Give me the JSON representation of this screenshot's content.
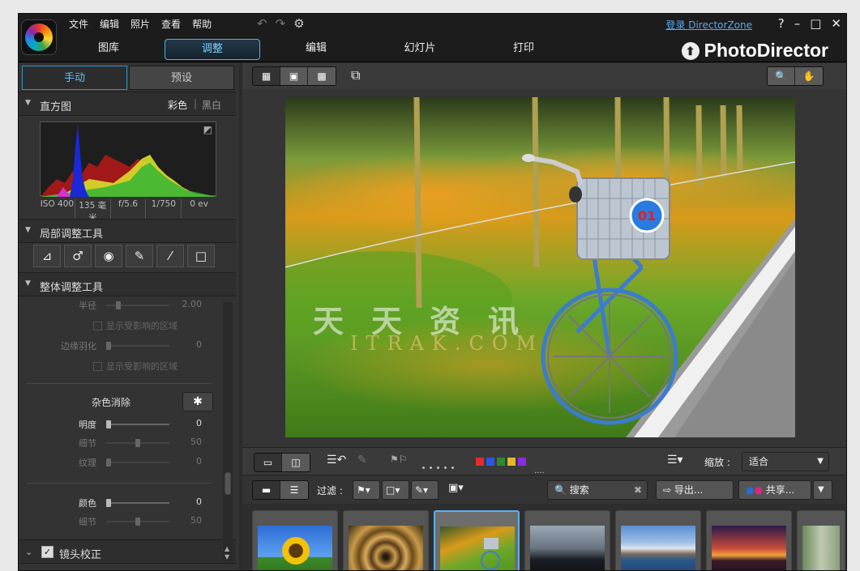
{
  "menu": [
    "文件",
    "编辑",
    "照片",
    "查看",
    "帮助"
  ],
  "toolbar_icons": [
    "undo-icon",
    "redo-icon",
    "settings-icon"
  ],
  "login_link": "登录 DirectorZone",
  "window_controls": {
    "help": "?",
    "minimize": "–",
    "maximize": "□",
    "close": "✕"
  },
  "main_tabs": [
    {
      "label": "图库",
      "active": false
    },
    {
      "label": "调整",
      "active": true
    },
    {
      "label": "编辑",
      "active": false
    },
    {
      "label": "幻灯片",
      "active": false
    },
    {
      "label": "打印",
      "active": false
    }
  ],
  "brand": "PhotoDirector",
  "left": {
    "subtabs": [
      "手动",
      "预设"
    ],
    "histogram": {
      "title": "直方图",
      "mode_color": "彩色",
      "mode_bw": "黑白",
      "exif": [
        "ISO 400",
        "135 毫米",
        "f/5.6",
        "1/750",
        "0 ev"
      ]
    },
    "local_tools": {
      "title": "局部调整工具",
      "icons": [
        "crop-icon",
        "spot-removal-icon",
        "red-eye-icon",
        "brush-icon",
        "gradient-icon",
        "radial-icon"
      ]
    },
    "global_tools": {
      "title": "整体调整工具"
    },
    "sliders1": [
      {
        "label": "半径",
        "value": "2.00",
        "pos": 0.15
      },
      {
        "label": "边缘羽化",
        "value": "0",
        "pos": 0.0
      }
    ],
    "show_affected": "显示受影响的区域",
    "noise": {
      "title": "杂色消除",
      "icon": "magic-wand-icon"
    },
    "sliders2": [
      {
        "label": "明度",
        "value": "0",
        "pos": 0.0,
        "dim": false
      },
      {
        "label": "细节",
        "value": "50",
        "pos": 0.5,
        "dim": true
      },
      {
        "label": "纹理",
        "value": "0",
        "pos": 0.0,
        "dim": true
      }
    ],
    "sliders3": [
      {
        "label": "颜色",
        "value": "0",
        "pos": 0.0,
        "dim": false
      },
      {
        "label": "细节",
        "value": "50",
        "pos": 0.5,
        "dim": true
      }
    ],
    "lens": {
      "title": "镜头校正",
      "checked": true
    }
  },
  "viewer": {
    "view_icons": [
      "grid-view-icon",
      "single-view-icon",
      "thumbnail-view-icon"
    ],
    "compare_icon": "compare-icon",
    "zoom_icon": "zoom-icon",
    "hand_icon": "hand-icon",
    "watermark_cn": "天天资讯",
    "watermark_en": "ITRAK.COM",
    "basket_label": "01"
  },
  "filter_bar": {
    "zoom_label": "缩放 :",
    "zoom_value": "适合",
    "color_labels": [
      "#e52b2b",
      "#2b57e5",
      "#2f8a2f",
      "#e5b82b",
      "#8a2be5"
    ]
  },
  "bottom_bar": {
    "filter_label": "过滤 :",
    "search_placeholder": "搜索",
    "export": "导出...",
    "share": "共享..."
  },
  "thumbnails": [
    {
      "name": "sunflower",
      "selected": false
    },
    {
      "name": "spiral-staircase",
      "selected": false
    },
    {
      "name": "bicycle",
      "selected": true
    },
    {
      "name": "dark-lake",
      "selected": false
    },
    {
      "name": "mountain-lake",
      "selected": false
    },
    {
      "name": "sunset",
      "selected": false
    },
    {
      "name": "partial",
      "selected": false
    }
  ]
}
